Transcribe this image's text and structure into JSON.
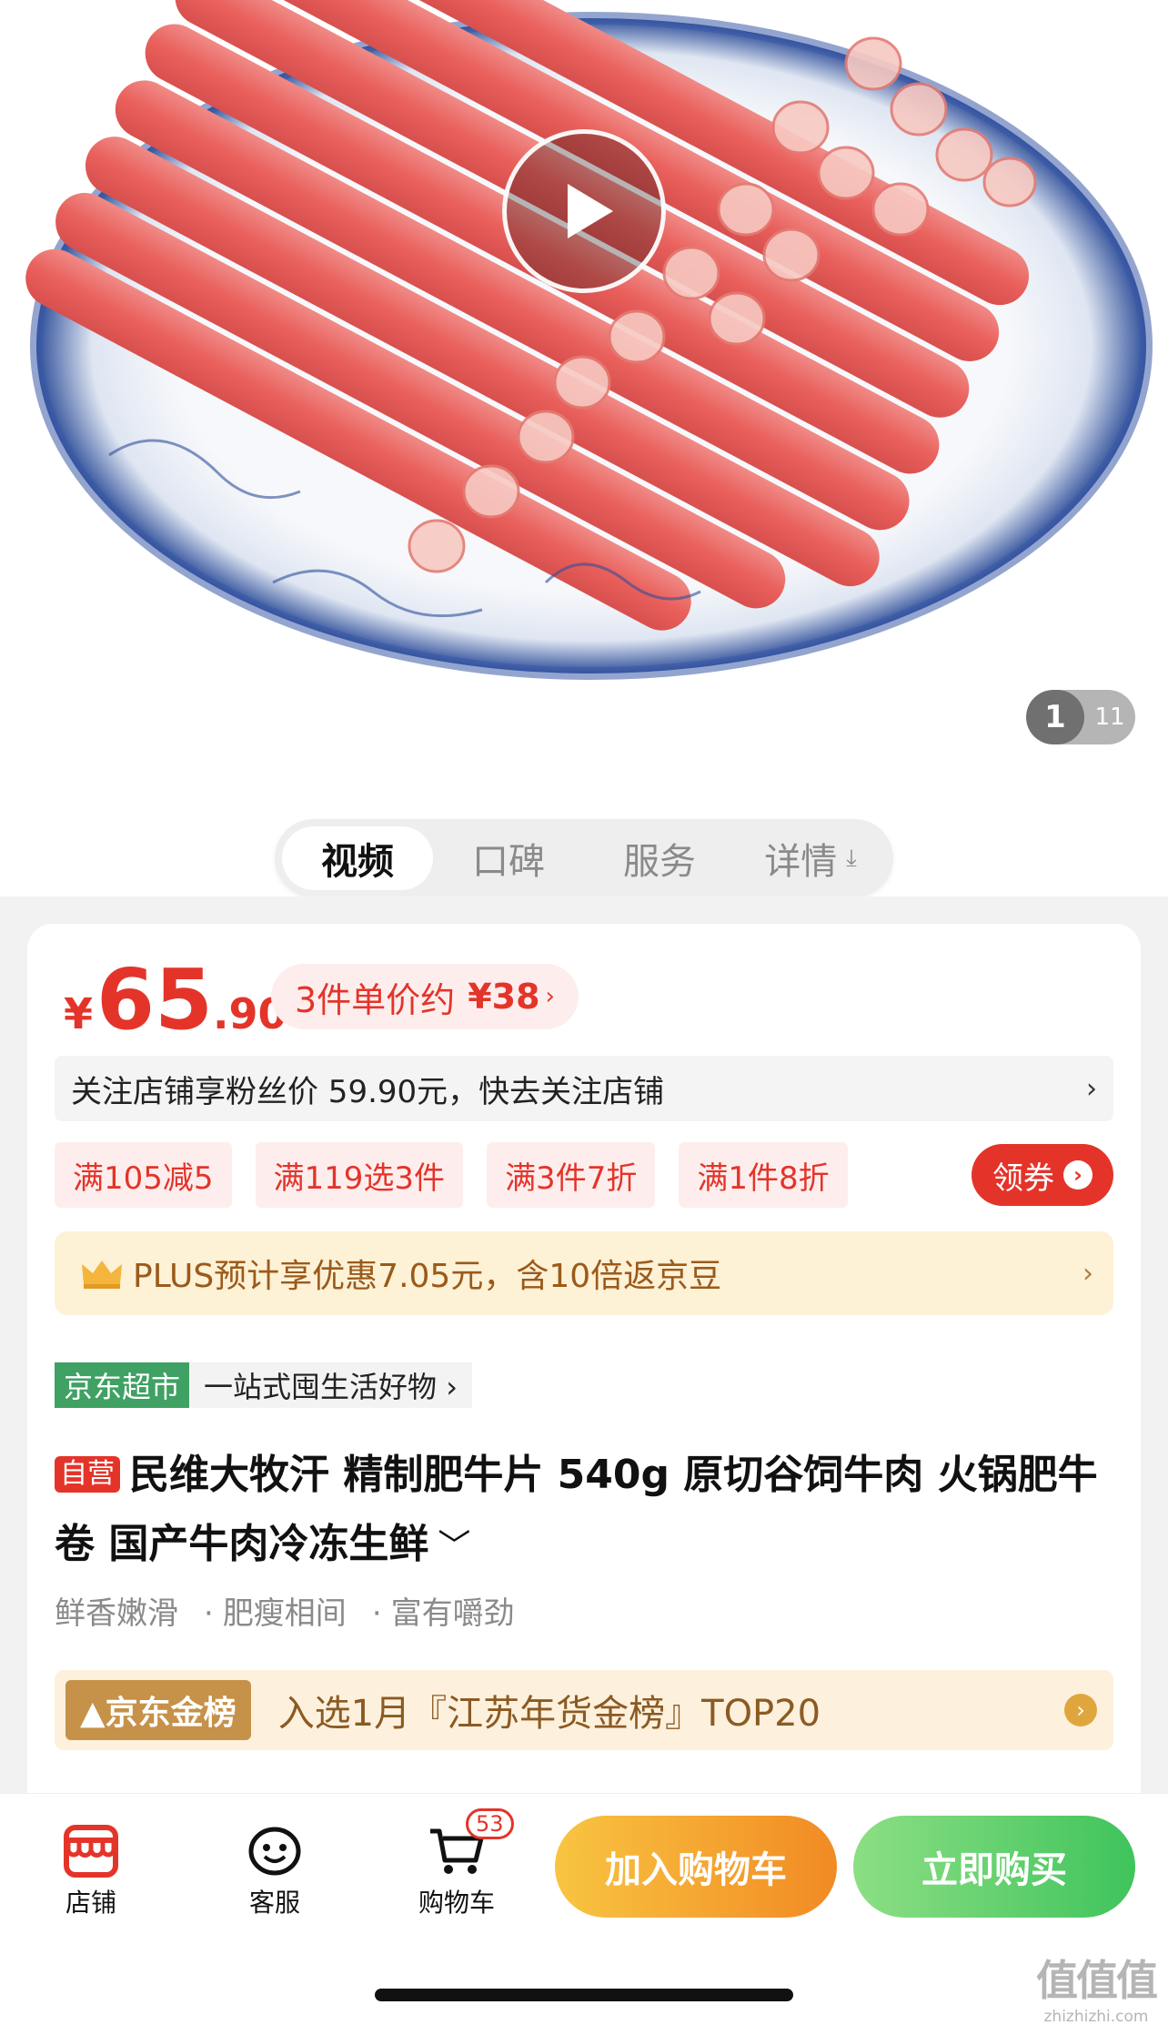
{
  "gallery": {
    "page_current": "1",
    "page_total": "11"
  },
  "tabs": [
    {
      "label": "视频",
      "active": true
    },
    {
      "label": "口碑",
      "active": false
    },
    {
      "label": "服务",
      "active": false
    },
    {
      "label": "详情",
      "active": false
    }
  ],
  "tab_download_icon": "⤓",
  "price": {
    "yen": "¥",
    "integer": "65",
    "decimal": ".90",
    "unit_price_label": "3件单价约",
    "unit_price_value": "¥38",
    "unit_price_arrow": "›"
  },
  "fans_notice": {
    "text": "关注店铺享粉丝价 59.90元，快去关注店铺",
    "chevron": "›"
  },
  "promos": [
    "满105减5",
    "满119选3件",
    "满3件7折",
    "满1件8折"
  ],
  "coupon_button": {
    "label": "领券",
    "icon": "›"
  },
  "plus": {
    "text": "PLUS预计享优惠7.05元，含10倍返京豆",
    "chevron": "›"
  },
  "store_tag": {
    "badge": "京东超市",
    "slogan": "一站式囤生活好物 ›"
  },
  "product": {
    "self_operated": "自营",
    "title": "民维大牧汗 精制肥牛片 540g 原切谷饲牛肉 火锅肥牛卷 国产牛肉冷冻生鲜",
    "expand_icon": "﹀"
  },
  "features": [
    "鲜香嫩滑",
    "肥瘦相间",
    "富有嚼劲"
  ],
  "feature_dot": "·",
  "ranking": {
    "badge": "▲京东金榜",
    "text": "入选1月『江苏年货金榜』TOP20",
    "arrow": "›"
  },
  "bottom_bar": {
    "store_label": "店铺",
    "service_label": "客服",
    "cart_label": "购物车",
    "cart_count": "53",
    "add_to_cart": "加入购物车",
    "buy_now": "立即购买"
  },
  "watermark": {
    "mark": "值值值",
    "site": "zhizhizhi.com"
  },
  "colors": {
    "accent_red": "#e4342a",
    "plus_gold": "#fdf1d6",
    "jd_green": "#3fa163",
    "cart_orange": "#f28a24",
    "buy_green": "#3fc45c"
  }
}
